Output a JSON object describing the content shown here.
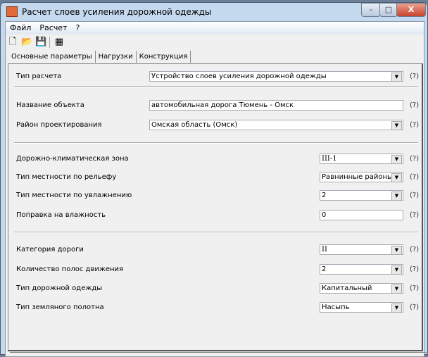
{
  "window": {
    "title": "Расчет слоев усиления дорожной одежды",
    "minimize": "–",
    "maximize": "□",
    "close": "X"
  },
  "menu": [
    "Файл",
    "Расчет",
    "?"
  ],
  "toolbar": {
    "new": "🗋",
    "open": "📂",
    "save": "💾",
    "calc": "▦"
  },
  "tabs": [
    "Основные параметры",
    "Нагрузки",
    "Конструкция"
  ],
  "help": "(?)",
  "fields": [
    {
      "label": "Тип расчета",
      "value": "Устройство слоев усиления дорожной одежды",
      "type": "select"
    },
    {
      "label": "Название объекта",
      "value": "автомобильная дорога Тюмень - Омск",
      "type": "input"
    },
    {
      "label": "Район проектирования",
      "value": "Омская область (Омск)",
      "type": "select"
    },
    {
      "label": "Дорожно-климатическая зона",
      "value": "III-1",
      "type": "select"
    },
    {
      "label": "Тип местности по рельефу",
      "value": "Равнинные районы",
      "type": "select"
    },
    {
      "label": "Тип местности по увлажнению",
      "value": "2",
      "type": "select"
    },
    {
      "label": "Поправка на влажность",
      "value": "0",
      "type": "input"
    },
    {
      "label": "Категория дороги",
      "value": "II",
      "type": "select"
    },
    {
      "label": "Количество полос движения",
      "value": "2",
      "type": "select"
    },
    {
      "label": "Тип дорожной одежды",
      "value": "Капитальный",
      "type": "select"
    },
    {
      "label": "Тип земляного полотна",
      "value": "Насыпь",
      "type": "select"
    }
  ]
}
